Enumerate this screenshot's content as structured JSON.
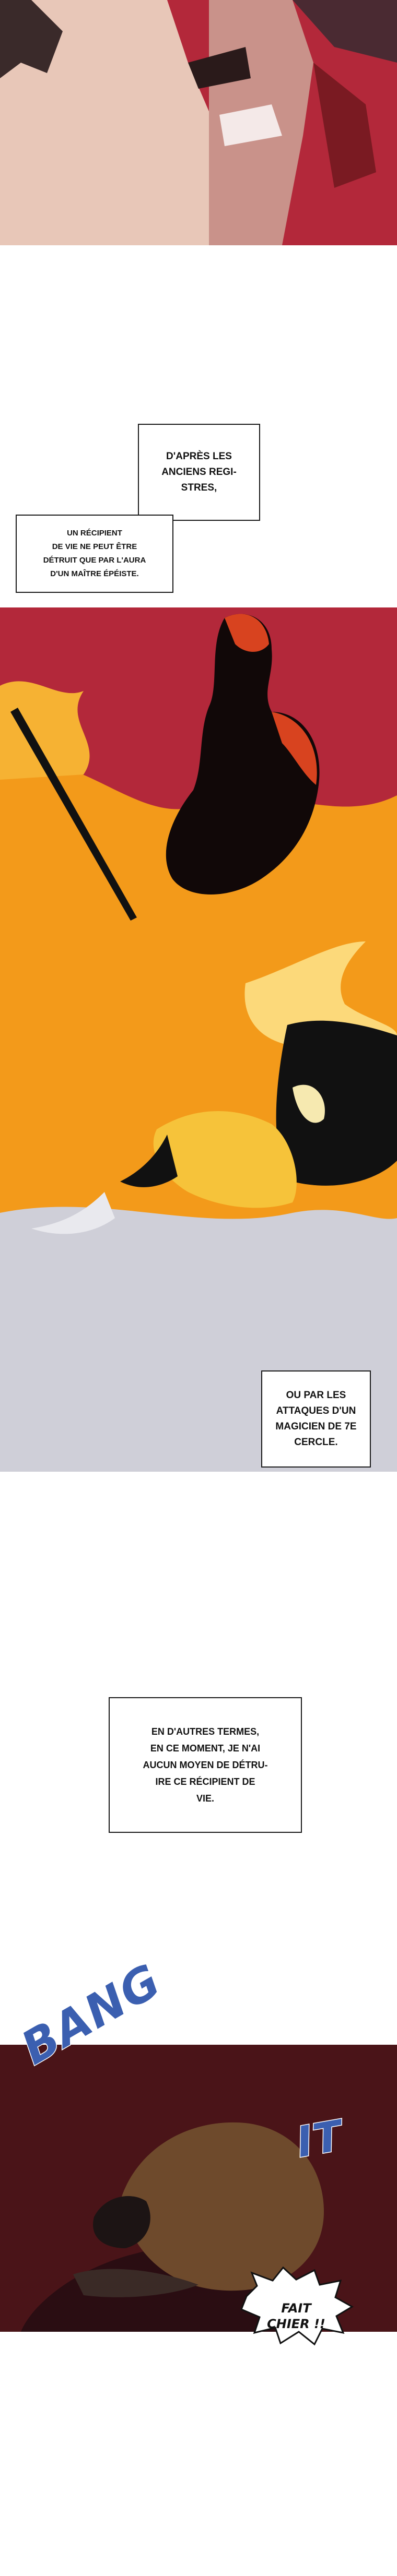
{
  "colors": {
    "red_bg": "#b3283a",
    "orange_bg": "#f39a1a",
    "grey_bg": "#cfcfd8",
    "dark_bg": "#2a0d12",
    "sfx_blue": "#3b5fb0"
  },
  "captions": {
    "registers": "D'APRÈS LES\nANCIENS REGI-\nSTRES,",
    "vessel": "UN RÉCIPIENT\nDE VIE NE PEUT ÊTRE\nDÉTRUIT QUE PAR L'AURA\nD'UN MAÎTRE ÉPÉISTE.",
    "magician": "OU PAR LES\nATTAQUES D'UN\nMAGICIEN DE 7E\nCERCLE.",
    "no_way": "EN D'AUTRES TERMES,\nEN CE MOMENT, JE N'AI\nAUCUN MOYEN DE DÉTRU-\nIRE CE RÉCIPIENT DE\nVIE."
  },
  "sfx": {
    "bang": "BANG",
    "it": "IT"
  },
  "speech": {
    "curse": "FAIT\nCHIER !!"
  }
}
